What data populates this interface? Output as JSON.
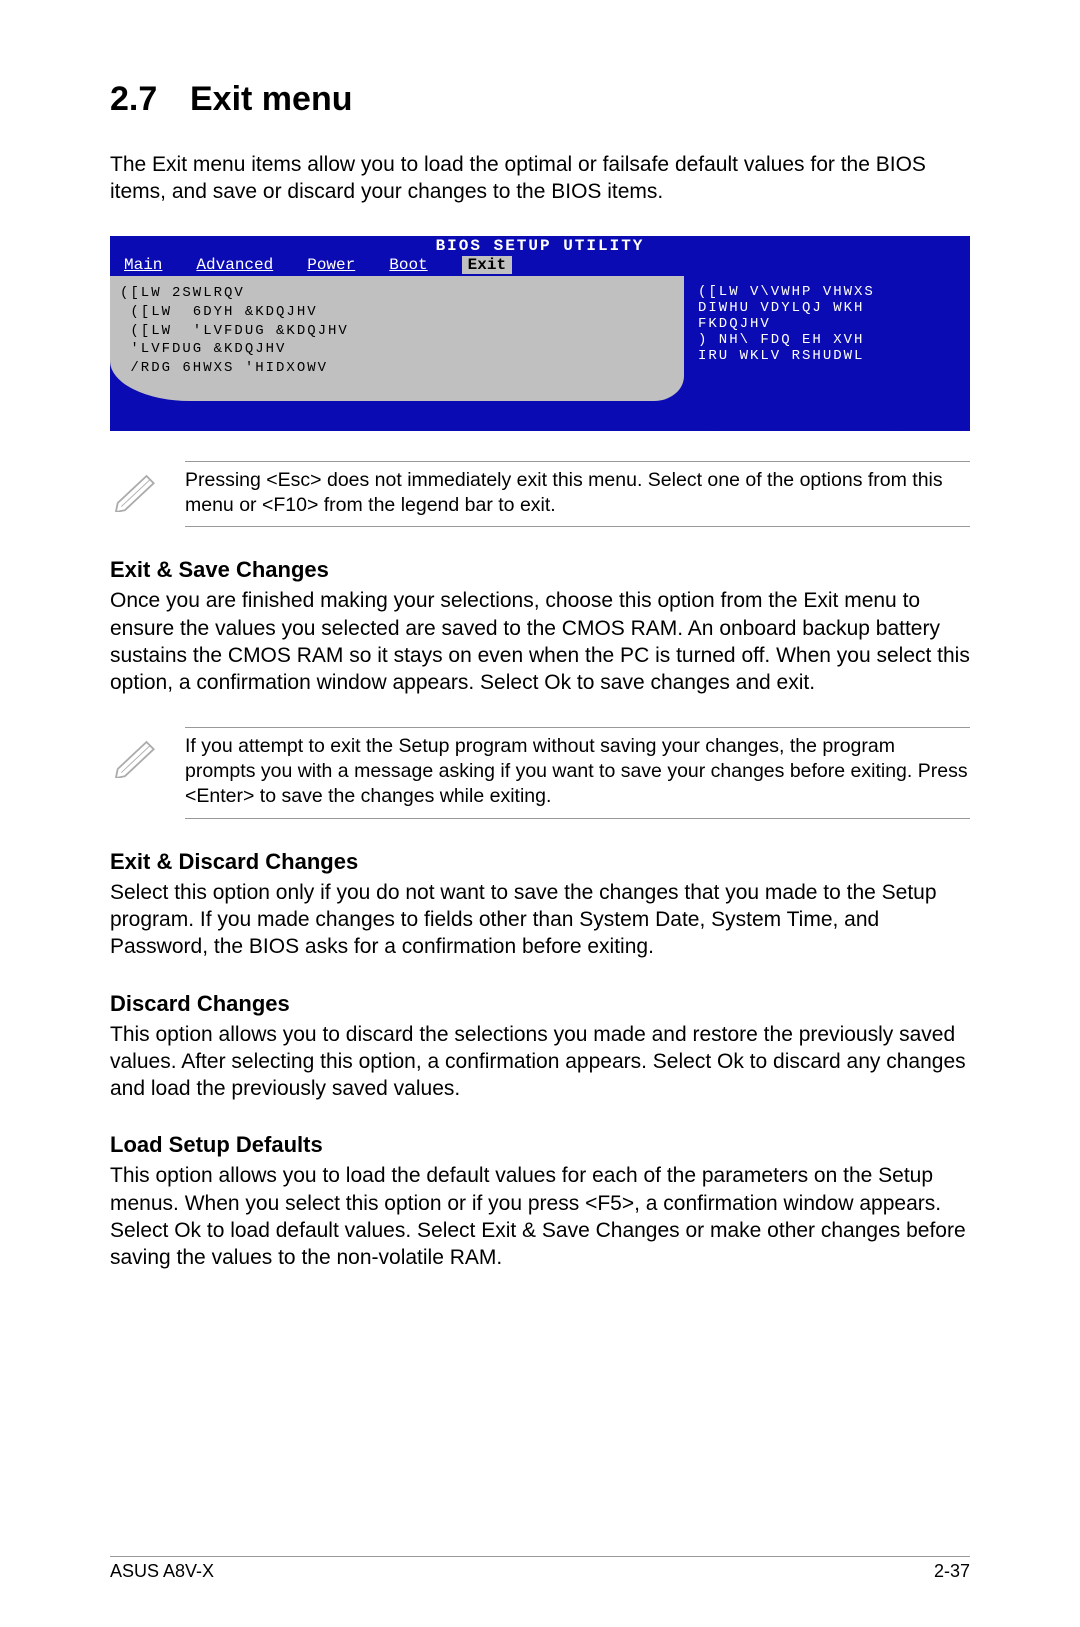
{
  "header": {
    "number": "2.7",
    "title": "Exit menu"
  },
  "intro": "The Exit menu items allow you to load the optimal or failsafe default values for the BIOS items, and save or discard your changes to the BIOS items.",
  "bios": {
    "title": "BIOS SETUP UTILITY",
    "tabs": [
      "Main",
      "Advanced",
      "Power",
      "Boot",
      "Exit"
    ],
    "active_tab": "Exit",
    "left_lines": [
      "([LW 2SWLRQV",
      "",
      " ([LW  6DYH &KDQJHV",
      " ([LW  'LVFDUG &KDQJHV",
      " 'LVFDUG &KDQJHV",
      "",
      " /RDG 6HWXS 'HIDXOWV"
    ],
    "right_lines": [
      "([LW V\\VWHP VHWXS",
      "DIWHU VDYLQJ WKH",
      "FKDQJHV",
      "",
      ")  NH\\ FDQ EH XVH",
      "IRU WKLV RSHUDWL"
    ]
  },
  "note1": "Pressing <Esc> does not immediately exit this menu. Select one of the options from this menu or <F10> from the legend bar to exit.",
  "sections": {
    "s1": {
      "title": "Exit & Save Changes",
      "body": "Once you are finished making your selections, choose this option from the Exit menu to ensure the values you selected are saved to the CMOS RAM. An onboard backup battery sustains the CMOS RAM so it stays on even when the PC is turned off. When you select this option, a confirmation window appears. Select Ok to save changes and exit."
    },
    "s2": {
      "title": "Exit & Discard Changes",
      "body": "Select this option only if you do not want to save the changes that you made to the Setup program. If you made changes to fields other than System Date, System Time, and Password, the BIOS asks for a confirmation before exiting."
    },
    "s3": {
      "title": "Discard Changes",
      "body": "This option allows you to discard the selections you made and restore the previously saved values. After selecting this option, a confirmation appears. Select Ok to discard any changes and load the previously saved values."
    },
    "s4": {
      "title": "Load Setup Defaults",
      "body": "This option allows you to load the default values for each of the parameters on the Setup menus. When you select this option or if you press <F5>, a confirmation window appears. Select Ok to load default values. Select Exit & Save Changes or make other changes before saving the values to the non-volatile RAM."
    }
  },
  "note2": "If you attempt to exit the Setup program without saving your changes, the program prompts you with a message asking if you want to save your changes before exiting. Press <Enter>  to save the  changes while exiting.",
  "footer": {
    "left": "ASUS A8V-X",
    "right": "2-37"
  }
}
